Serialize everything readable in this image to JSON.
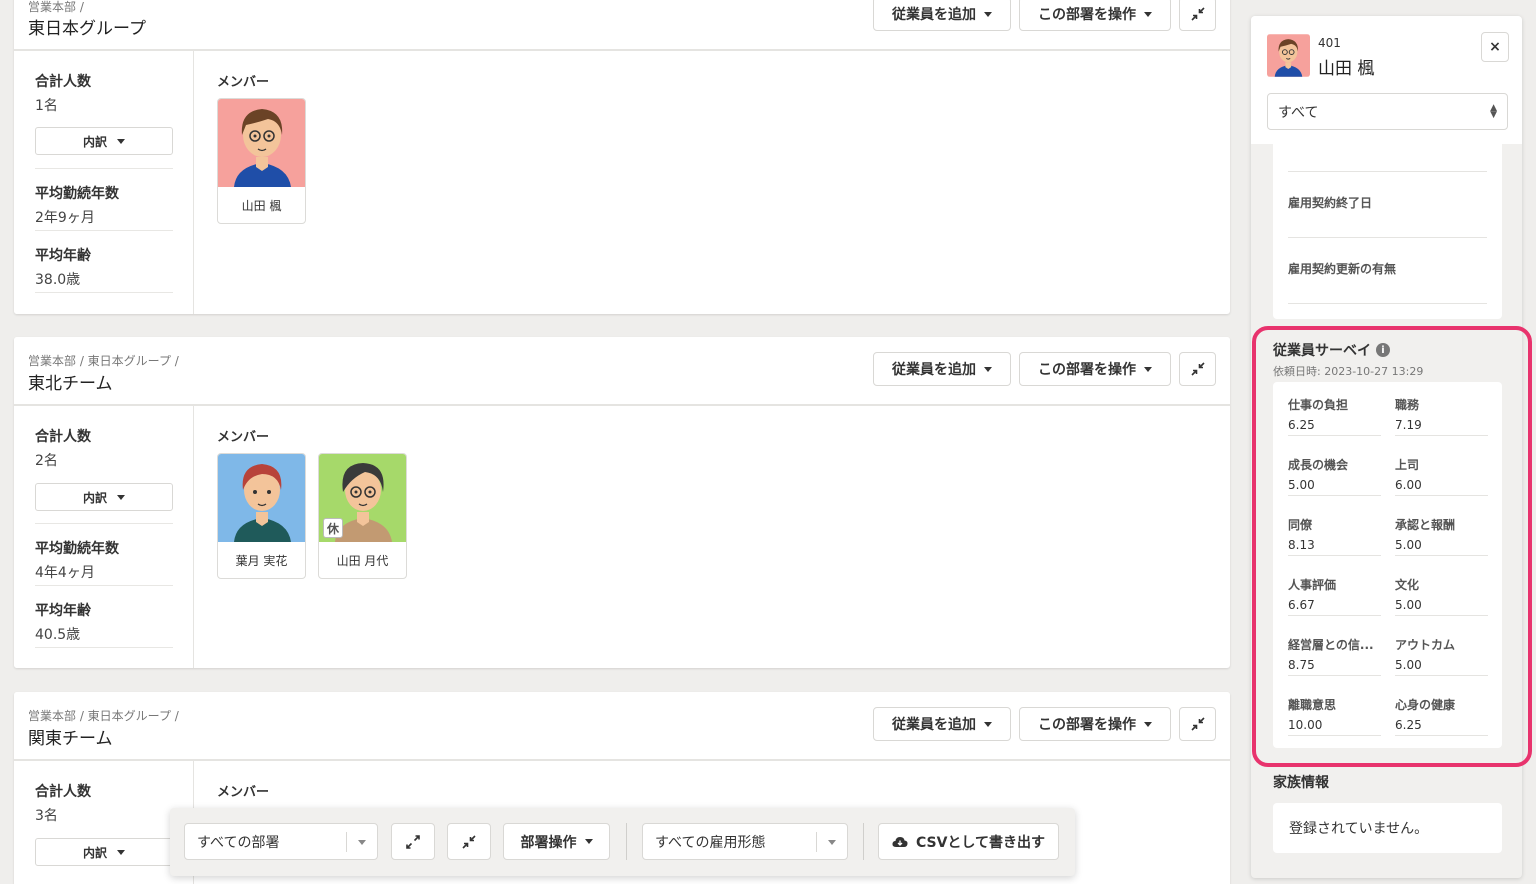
{
  "departments": [
    {
      "breadcrumb": "営業本部 /",
      "name": "東日本グループ",
      "add_employee_label": "従業員を追加",
      "dept_action_label": "この部署を操作",
      "total_label": "合計人数",
      "total_value": "1名",
      "breakdown_label": "内訳",
      "tenure_label": "平均勤続年数",
      "tenure_value": "2年9ヶ月",
      "age_label": "平均年齢",
      "age_value": "38.0歳",
      "members_label": "メンバー",
      "members": [
        {
          "name": "山田 楓"
        }
      ]
    },
    {
      "breadcrumb": "営業本部 / 東日本グループ /",
      "name": "東北チーム",
      "add_employee_label": "従業員を追加",
      "dept_action_label": "この部署を操作",
      "total_label": "合計人数",
      "total_value": "2名",
      "breakdown_label": "内訳",
      "tenure_label": "平均勤続年数",
      "tenure_value": "4年4ヶ月",
      "age_label": "平均年齢",
      "age_value": "40.5歳",
      "members_label": "メンバー",
      "members": [
        {
          "name": "葉月 実花"
        },
        {
          "name": "山田 月代",
          "badge": "休"
        }
      ]
    },
    {
      "breadcrumb": "営業本部 / 東日本グループ /",
      "name": "関東チーム",
      "add_employee_label": "従業員を追加",
      "dept_action_label": "この部署を操作",
      "total_label": "合計人数",
      "total_value": "3名",
      "breakdown_label": "内訳",
      "members_label": "メンバー"
    }
  ],
  "toolbar": {
    "dept_filter_value": "すべての部署",
    "dept_ops_label": "部署操作",
    "employment_filter_value": "すべての雇用形態",
    "csv_label": "CSVとして書き出す"
  },
  "panel": {
    "employee_id": "401",
    "employee_name": "山田 楓",
    "close_symbol": "×",
    "filter_value": "すべて",
    "contract_fields": [
      "雇用契約終了日",
      "雇用契約更新の有無"
    ],
    "survey": {
      "title": "従業員サーベイ",
      "requested_at": "依頼日時: 2023-10-27 13:29",
      "items": [
        {
          "label": "仕事の負担",
          "value": "6.25"
        },
        {
          "label": "職務",
          "value": "7.19"
        },
        {
          "label": "成長の機会",
          "value": "5.00"
        },
        {
          "label": "上司",
          "value": "6.00"
        },
        {
          "label": "同僚",
          "value": "8.13"
        },
        {
          "label": "承認と報酬",
          "value": "5.00"
        },
        {
          "label": "人事評価",
          "value": "6.67"
        },
        {
          "label": "文化",
          "value": "5.00"
        },
        {
          "label": "経営層との信...",
          "value": "8.75"
        },
        {
          "label": "アウトカム",
          "value": "5.00"
        },
        {
          "label": "離職意思",
          "value": "10.00"
        },
        {
          "label": "心身の健康",
          "value": "6.25"
        }
      ]
    },
    "family_title": "家族情報",
    "family_empty": "登録されていません。"
  },
  "colors": {
    "highlight": "#e8336d",
    "avatar_pink": "#f6a19c",
    "avatar_blue": "#7fb8e8",
    "avatar_green": "#a6d96a"
  }
}
